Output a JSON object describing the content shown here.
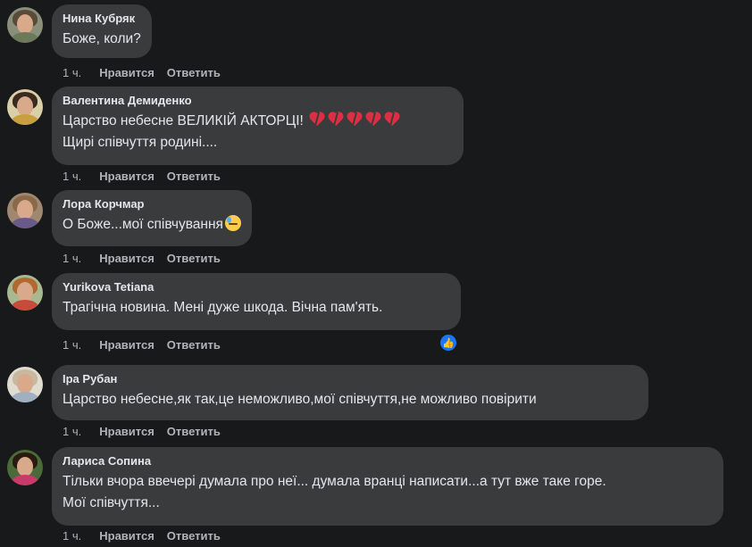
{
  "comments": [
    {
      "author": "Нина Кубряк",
      "lines": [
        "Боже, коли?"
      ],
      "time": "1 ч.",
      "like": "Нравится",
      "reply": "Ответить",
      "avatar_colors": {
        "hair": "#5a4a3a",
        "body": "#6b7a5a",
        "bg": "#8a8f7a"
      }
    },
    {
      "author": "Валентина Демиденко",
      "lines": [
        "Царство небесне ВЕЛИКІЙ АКТОРЦІ!",
        "Щирі співчуття родині...."
      ],
      "time": "1 ч.",
      "like": "Нравится",
      "reply": "Ответить",
      "emoji": "broken-heart-x5",
      "avatar_colors": {
        "hair": "#3b2a1e",
        "body": "#c8a040",
        "bg": "#d9cfa8"
      }
    },
    {
      "author": "Лора Корчмар",
      "lines": [
        "О Боже...мої співчування"
      ],
      "time": "1 ч.",
      "like": "Нравится",
      "reply": "Ответить",
      "emoji": "downcast-sweat-face",
      "avatar_colors": {
        "hair": "#8a6a4a",
        "body": "#6a5a8a",
        "bg": "#a08870"
      }
    },
    {
      "author": "Yurikova Tetiana",
      "lines": [
        "Трагічна новина. Мені дуже шкода. Вічна пам'ять."
      ],
      "time": "1 ч.",
      "like": "Нравится",
      "reply": "Ответить",
      "reaction": "like",
      "avatar_colors": {
        "hair": "#b06a30",
        "body": "#c84a3a",
        "bg": "#a8b890"
      }
    },
    {
      "author": "Іра Рубан",
      "lines": [
        "Царство небесне,як так,це неможливо,мої співчуття,не можливо повірити"
      ],
      "time": "1 ч.",
      "like": "Нравится",
      "reply": "Ответить",
      "avatar_colors": {
        "hair": "#c8b8a0",
        "body": "#a0b0c0",
        "bg": "#e0ddd0"
      }
    },
    {
      "author": "Лариса Сопина",
      "lines": [
        "Тільки вчора ввечері думала про неї... думала вранці написати...а тут вже таке горе.",
        "Мої співчуття..."
      ],
      "time": "1 ч.",
      "like": "Нравится",
      "reply": "Ответить",
      "avatar_colors": {
        "hair": "#2a1a10",
        "body": "#c83a6a",
        "bg": "#4a6a3a"
      }
    }
  ],
  "colors": {
    "background": "#18191a",
    "bubble": "#3a3b3c",
    "text": "#e4e6eb",
    "meta": "#b0b3b8",
    "like_reaction": "#1877f2"
  }
}
